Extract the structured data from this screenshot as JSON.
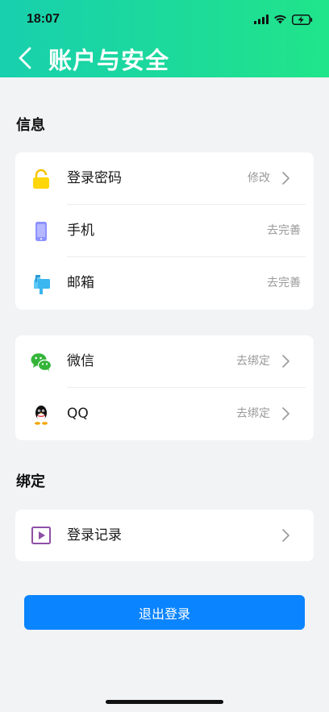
{
  "status_bar": {
    "time": "18:07"
  },
  "header": {
    "title": "账户与安全"
  },
  "sections": {
    "info_title": "信息",
    "bind_title": "绑定"
  },
  "info_rows": [
    {
      "label": "登录密码",
      "value": "修改",
      "icon": "lock-icon"
    },
    {
      "label": "手机",
      "value": "去完善",
      "icon": "phone-icon"
    },
    {
      "label": "邮箱",
      "value": "去完善",
      "icon": "mailbox-icon"
    }
  ],
  "social_rows": [
    {
      "label": "微信",
      "value": "去绑定",
      "icon": "wechat-icon"
    },
    {
      "label": "QQ",
      "value": "去绑定",
      "icon": "qq-icon"
    }
  ],
  "record_row": {
    "label": "登录记录",
    "icon": "play-record-icon"
  },
  "logout_label": "退出登录",
  "colors": {
    "header_start": "#18d0ae",
    "header_end": "#21e58a",
    "primary_button": "#0a84ff",
    "background": "#f2f3f5"
  }
}
